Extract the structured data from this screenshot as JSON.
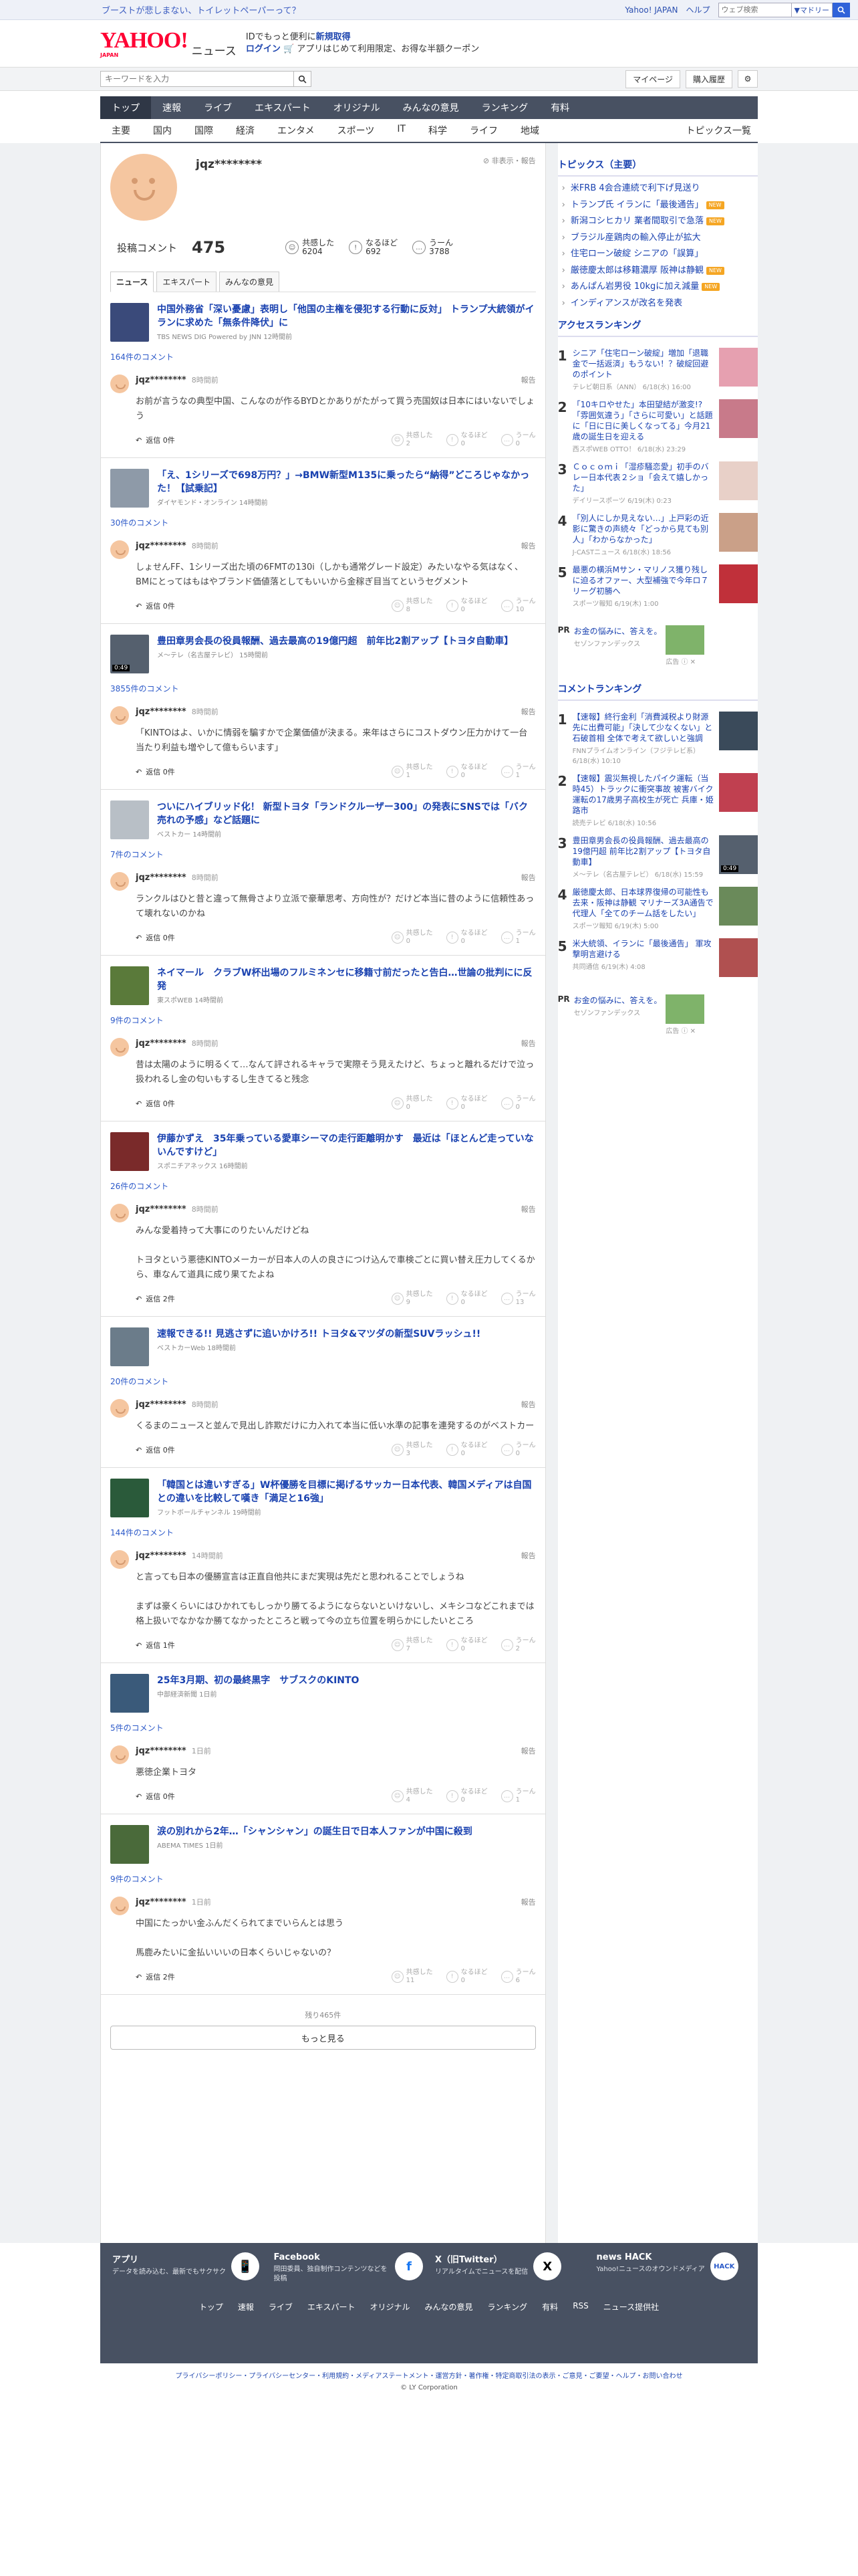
{
  "topstrip": {
    "promo": "ブーストが悲しまない、トイレットペーパーって？",
    "yahoo": "Yahoo! JAPAN",
    "help": "ヘルプ",
    "search_placeholder": "ウェブ検索",
    "select": "▼マドリー"
  },
  "header": {
    "logo": "YAHOO!",
    "logo_sub": "JAPAN",
    "logo_news": "ニュース",
    "msg1_a": "IDでもっと便利に",
    "msg1_b": "新規取得",
    "msg2_a": "ログイン",
    "msg2_b": "🛒 アプリはじめて利用限定、お得な半額クーポン"
  },
  "search": {
    "placeholder": "キーワードを入力",
    "mypage": "マイページ",
    "history": "購入履歴"
  },
  "mainnav": [
    "トップ",
    "速報",
    "ライブ",
    "エキスパート",
    "オリジナル",
    "みんなの意見",
    "ランキング",
    "有料"
  ],
  "subnav": [
    "主要",
    "国内",
    "国際",
    "経済",
    "エンタメ",
    "スポーツ",
    "IT",
    "科学",
    "ライフ",
    "地域"
  ],
  "subnav_all": "トピックス一覧",
  "profile": {
    "name": "jqz********",
    "report": "⊘ 非表示・報告",
    "posts_label": "投稿コメント",
    "posts": "475",
    "r1": "共感した",
    "r1v": "6204",
    "r2": "なるほど",
    "r2v": "692",
    "r3": "うーん",
    "r3v": "3788"
  },
  "tabs": [
    "ニュース",
    "エキスパート",
    "みんなの意見"
  ],
  "items": [
    {
      "title": "中国外務省「深い憂慮」表明し「他国の主権を侵犯する行動に反対」 トランプ大統領がイランに求めた「無条件降伏」に",
      "src": "TBS NEWS DIG Powered by JNN 12時間前",
      "count": "164件のコメント",
      "user": "jqz********",
      "time": "8時間前",
      "text": "お前が言うなの典型中国、こんなのが作るBYDとかありがたがって買う売国奴は日本にはいないでしょう",
      "reply": "返信 0件",
      "a": "2",
      "b": "0",
      "c": "0",
      "thumb": "#3a4a7a",
      "dur": ""
    },
    {
      "title": "「え、1シリーズで698万円？」→BMW新型M135に乗ったら“納得”どころじゃなかった！【試乗記】",
      "src": "ダイヤモンド・オンライン 14時間前",
      "count": "30件のコメント",
      "user": "jqz********",
      "time": "8時間前",
      "text": "しょせんFF、1シリーズ出た頃の6FMTの130i（しかも通常グレード設定）みたいなやる気はなく、BMにとってはもはやブランド価値落としてもいいから金稼ぎ目当てというセグメント",
      "reply": "返信 0件",
      "a": "8",
      "b": "0",
      "c": "10",
      "thumb": "#8e9aa8",
      "dur": ""
    },
    {
      "title": "豊田章男会長の役員報酬、過去最高の19億円超　前年比2割アップ【トヨタ自動車】",
      "src": "メ～テレ（名古屋テレビ） 15時間前",
      "count": "3855件のコメント",
      "user": "jqz********",
      "time": "8時間前",
      "text": "「KINTOはよ、いかに情弱を騙すかで企業価値が決まる。来年はさらにコストダウン圧力かけて一台当たり利益も増やして億もらいます」",
      "reply": "返信 0件",
      "a": "1",
      "b": "0",
      "c": "1",
      "thumb": "#55606e",
      "dur": "0:49"
    },
    {
      "title": "ついにハイブリッド化！ 新型トヨタ「ランドクルーザー300」の発表にSNSでは「バク売れの予感」など話題に",
      "src": "ベストカー 14時間前",
      "count": "7件のコメント",
      "user": "jqz********",
      "time": "8時間前",
      "text": "ランクルはひと昔と違って無骨さより立派で豪華思考、方向性が？だけど本当に昔のように信頼性あって壊れないのかね",
      "reply": "返信 0件",
      "a": "0",
      "b": "0",
      "c": "1",
      "thumb": "#b8bfc6",
      "dur": ""
    },
    {
      "title": "ネイマール　クラブW杯出場のフルミネンセに移籍寸前だったと告白…世論の批判にに反発",
      "src": "東スポWEB 14時間前",
      "count": "9件のコメント",
      "user": "jqz********",
      "time": "8時間前",
      "text": "昔は太陽のように明るくて…なんて評されるキャラで実際そう見えたけど、ちょっと離れるだけで泣っ扱われるし金の匂いもするし生きてると残念",
      "reply": "返信 0件",
      "a": "0",
      "b": "0",
      "c": "0",
      "thumb": "#5a7a3a",
      "dur": ""
    },
    {
      "title": "伊藤かずえ　35年乗っている愛車シーマの走行距離明かす　最近は「ほとんど走っていないんですけど」",
      "src": "スポニチアネックス 16時間前",
      "count": "26件のコメント",
      "user": "jqz********",
      "time": "8時間前",
      "text": "みんな愛着持って大事にのりたいんだけどね\n\nトヨタという悪徳KINTOメーカーが日本人の人の良さにつけ込んで車検ごとに買い替え圧力してくるから、車なんて道具に成り果てたよね",
      "reply": "返信 2件",
      "a": "9",
      "b": "0",
      "c": "13",
      "thumb": "#7a2a2a",
      "dur": ""
    },
    {
      "title": "速報できる!! 見逃さずに追いかけろ!! トヨタ&マツダの新型SUVラッシュ!!",
      "src": "ベストカーWeb 18時間前",
      "count": "20件のコメント",
      "user": "jqz********",
      "time": "8時間前",
      "text": "くるまのニュースと並んで見出し詐欺だけに力入れて本当に低い水準の記事を連発するのがベストカー",
      "reply": "返信 0件",
      "a": "3",
      "b": "0",
      "c": "0",
      "thumb": "#6b7c8a",
      "dur": ""
    },
    {
      "title": "「韓国とは違いすぎる」W杯優勝を目標に掲げるサッカー日本代表、韓国メディアは自国との違いを比較して嘆き「満足と16強」",
      "src": "フットボールチャンネル 19時間前",
      "count": "144件のコメント",
      "user": "jqz********",
      "time": "14時間前",
      "text": "と言っても日本の優勝宣言は正直自他共にまだ実現は先だと思われることでしょうね\n\nまずは豪くらいにはひかれてもしっかり勝てるようにならないといけないし、メキシコなどこれまでは格上扱いでなかなか勝てなかったところと戦って今の立ち位置を明らかにしたいところ",
      "reply": "返信 1件",
      "a": "7",
      "b": "0",
      "c": "2",
      "thumb": "#2a5a3a",
      "dur": ""
    },
    {
      "title": "25年3月期、初の最終黒字　サブスクのKINTO",
      "src": "中部経済新聞 1日前",
      "count": "5件のコメント",
      "user": "jqz********",
      "time": "1日前",
      "text": "悪徳企業トヨタ",
      "reply": "返信 0件",
      "a": "4",
      "b": "0",
      "c": "1",
      "thumb": "#3a5a7a",
      "dur": ""
    },
    {
      "title": "涙の別れから2年…「シャンシャン」の誕生日で日本人ファンが中国に殺到",
      "src": "ABEMA TIMES 1日前",
      "count": "9件のコメント",
      "user": "jqz********",
      "time": "1日前",
      "text": "中国にたっかい金ふんだくられてまでいらんとは思う\n\n馬鹿みたいに金払いいいの日本くらいじゃないの？",
      "reply": "返信 2件",
      "a": "11",
      "b": "0",
      "c": "6",
      "thumb": "#4a6a3a",
      "dur": ""
    }
  ],
  "more": {
    "rest": "残り465件",
    "button": "もっと見る"
  },
  "right": {
    "topics_title": "トピックス（主要）",
    "topics": [
      {
        "t": "米FRB 4会合連続で利下げ見送り",
        "b": ""
      },
      {
        "t": "トランプ氏 イランに「最後通告」",
        "b": "NEW"
      },
      {
        "t": "新潟コシヒカリ 業者間取引で急落",
        "b": "NEW"
      },
      {
        "t": "ブラジル産鶏肉の輸入停止が拡大",
        "b": ""
      },
      {
        "t": "住宅ローン破綻 シニアの「誤算」",
        "b": ""
      },
      {
        "t": "厳徳慶太郎は移籍濃厚 阪神は静観",
        "b": "NEW"
      },
      {
        "t": "あんぱん岩男役 10kgに加え減量",
        "b": "NEW"
      },
      {
        "t": "インディアンスが改名を発表",
        "b": ""
      }
    ],
    "access_title": "アクセスランキング",
    "access": [
      {
        "t": "シニア「住宅ローン破綻」増加「退職金で一括返済」もうない！？破綻回避のポイント",
        "s": "テレビ朝日系（ANN） 6/18(水) 16:00",
        "c": "#e6a0b0",
        "d": ""
      },
      {
        "t": "「10キロやせた」本田望結が激変!?「雰囲気違う」「さらに可愛い」と話題に「日に日に美しくなってる」今月21歳の誕生日を迎える",
        "s": "西スポWEB OTTO！ 6/18(水) 23:29",
        "c": "#c87a8a",
        "d": ""
      },
      {
        "t": "Ｃｏｃｏｍｉ「湿疹騒恋愛」初手のバレー日本代表２ショ「会えて嬉しかった」",
        "s": "デイリースポーツ 6/19(木) 0:23",
        "c": "#e8d0c8",
        "d": ""
      },
      {
        "t": "「別人にしか見えない…」上戸彩の近影に驚きの声続々「どっから見ても別人」「わからなかった」",
        "s": "J-CASTニュース 6/18(水) 18:56",
        "c": "#caa088",
        "d": ""
      },
      {
        "t": "最悪の横浜Mサン・マリノス獲り残しに迫るオファー、大型補強で今年ロ７リーグ初勝へ",
        "s": "スポーツ報知 6/19(木) 1:00",
        "c": "#c0303a",
        "d": ""
      }
    ],
    "ad1": {
      "pr": "PR",
      "t": "お金の悩みに、答えを。",
      "s": "セゾンファンデックス",
      "x": "広告 ⓘ ✕"
    },
    "comment_title": "コメントランキング",
    "comment": [
      {
        "t": "【速報】終行金利「消費減税より財源先に出費可能」「決して少なくない」と石破首相 全体で考えて欲しいと強調",
        "s": "FNNプライムオンライン（フジテレビ系） 6/18(水) 10:10",
        "c": "#3a4a5a",
        "d": ""
      },
      {
        "t": "【速報】震災無視したパイク運転（当時45）トラックに衝突事故 被害バイク運転の17歳男子高校生が死亡 兵庫・姫路市",
        "s": "読売テレビ 6/18(水) 10:56",
        "c": "#c04050",
        "d": ""
      },
      {
        "t": "豊田章男会長の役員報酬、過去最高の19億円超 前年比2割アップ【トヨタ自動車】",
        "s": "メ～テレ（名古屋テレビ） 6/18(水) 15:59",
        "c": "#55606e",
        "d": "0:49"
      },
      {
        "t": "厳徳慶太郎、日本球界復帰の可能性も 去来・阪神は静観 マリナーズ3A通告で代理人「全てのチーム話をしたい」",
        "s": "スポーツ報知 6/19(木) 5:00",
        "c": "#6a8a5a",
        "d": ""
      },
      {
        "t": "米大統領、イランに「最後通告」 軍攻撃明言避ける",
        "s": "共同通信 6/19(木) 4:08",
        "c": "#b05050",
        "d": ""
      }
    ],
    "ad2": {
      "pr": "PR",
      "t": "お金の悩みに、答えを。",
      "s": "セゾンファンデックス",
      "x": "広告 ⓘ ✕"
    }
  },
  "footer": {
    "apps": [
      {
        "t": "アプリ",
        "d": "データを読み込む、最新でもサクサク",
        "i": "📱"
      },
      {
        "t": "Facebook",
        "d": "岡田委員、独自制作コンテンツなどを投稿",
        "i": "f"
      },
      {
        "t": "X（旧Twitter）",
        "d": "リアルタイムでニュースを配信",
        "i": "X"
      },
      {
        "t": "news HACK",
        "d": "Yahoo!ニュースのオウンドメディア",
        "i": "HACK"
      }
    ],
    "links": [
      "トップ",
      "速報",
      "ライブ",
      "エキスパート",
      "オリジナル",
      "みんなの意見",
      "ランキング",
      "有料",
      "RSS",
      "ニュース提供社"
    ],
    "legal": "プライバシーポリシー・プライバシーセンター・利用規約・メディアステートメント・運営方針・著作権・特定商取引法の表示・ご意見・ご要望・ヘルプ・お問い合わせ",
    "copy": "© LY Corporation"
  }
}
